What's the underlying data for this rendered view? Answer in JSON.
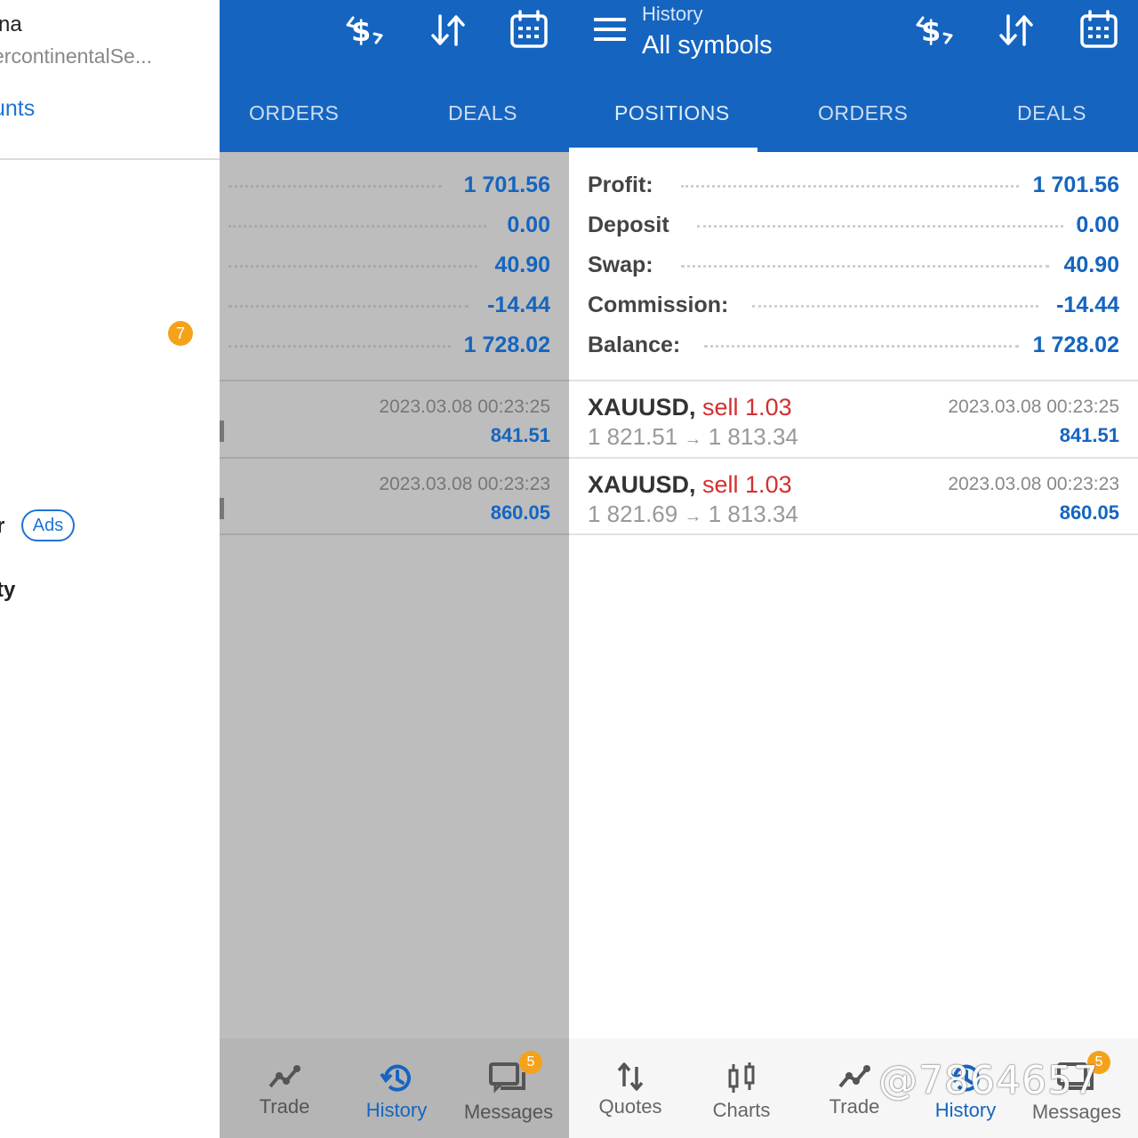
{
  "drawer": {
    "name_fragment": "na",
    "server_fragment": "ercontinentalSe...",
    "accounts_fragment": "unts",
    "notification_count": "7",
    "menu_item_fragment_1": "r",
    "ads_label": "Ads",
    "menu_item_fragment_2": "ty"
  },
  "header": {
    "subtitle": "History",
    "title": "All symbols"
  },
  "tabs": [
    "POSITIONS",
    "ORDERS",
    "DEALS"
  ],
  "summary": [
    {
      "label": "Profit:",
      "value": "1 701.56"
    },
    {
      "label": "Deposit",
      "value": "0.00"
    },
    {
      "label": "Swap:",
      "value": "40.90"
    },
    {
      "label": "Commission:",
      "value": "-14.44"
    },
    {
      "label": "Balance:",
      "value": "1 728.02"
    }
  ],
  "deals": [
    {
      "symbol": "XAUUSD,",
      "side": "sell 1.03",
      "open_price": "1 821.51",
      "arrow": "→",
      "close_price": "1 813.34",
      "time": "2023.03.08 00:23:25",
      "profit": "841.51"
    },
    {
      "symbol": "XAUUSD,",
      "side": "sell 1.03",
      "open_price": "1 821.69",
      "arrow": "→",
      "close_price": "1 813.34",
      "time": "2023.03.08 00:23:23",
      "profit": "860.05"
    }
  ],
  "bottom_nav": {
    "quotes": "Quotes",
    "charts": "Charts",
    "trade": "Trade",
    "history": "History",
    "messages": "Messages",
    "messages_badge": "5"
  },
  "icons": {
    "menu": "hamburger-icon",
    "deposit": "dollar-exchange-icon",
    "sort": "sort-arrows-icon",
    "calendar": "calendar-icon"
  },
  "colors": {
    "primary": "#1565c0",
    "sell": "#d32f2f",
    "badge": "#f5a21b"
  },
  "watermark": "@7864657"
}
